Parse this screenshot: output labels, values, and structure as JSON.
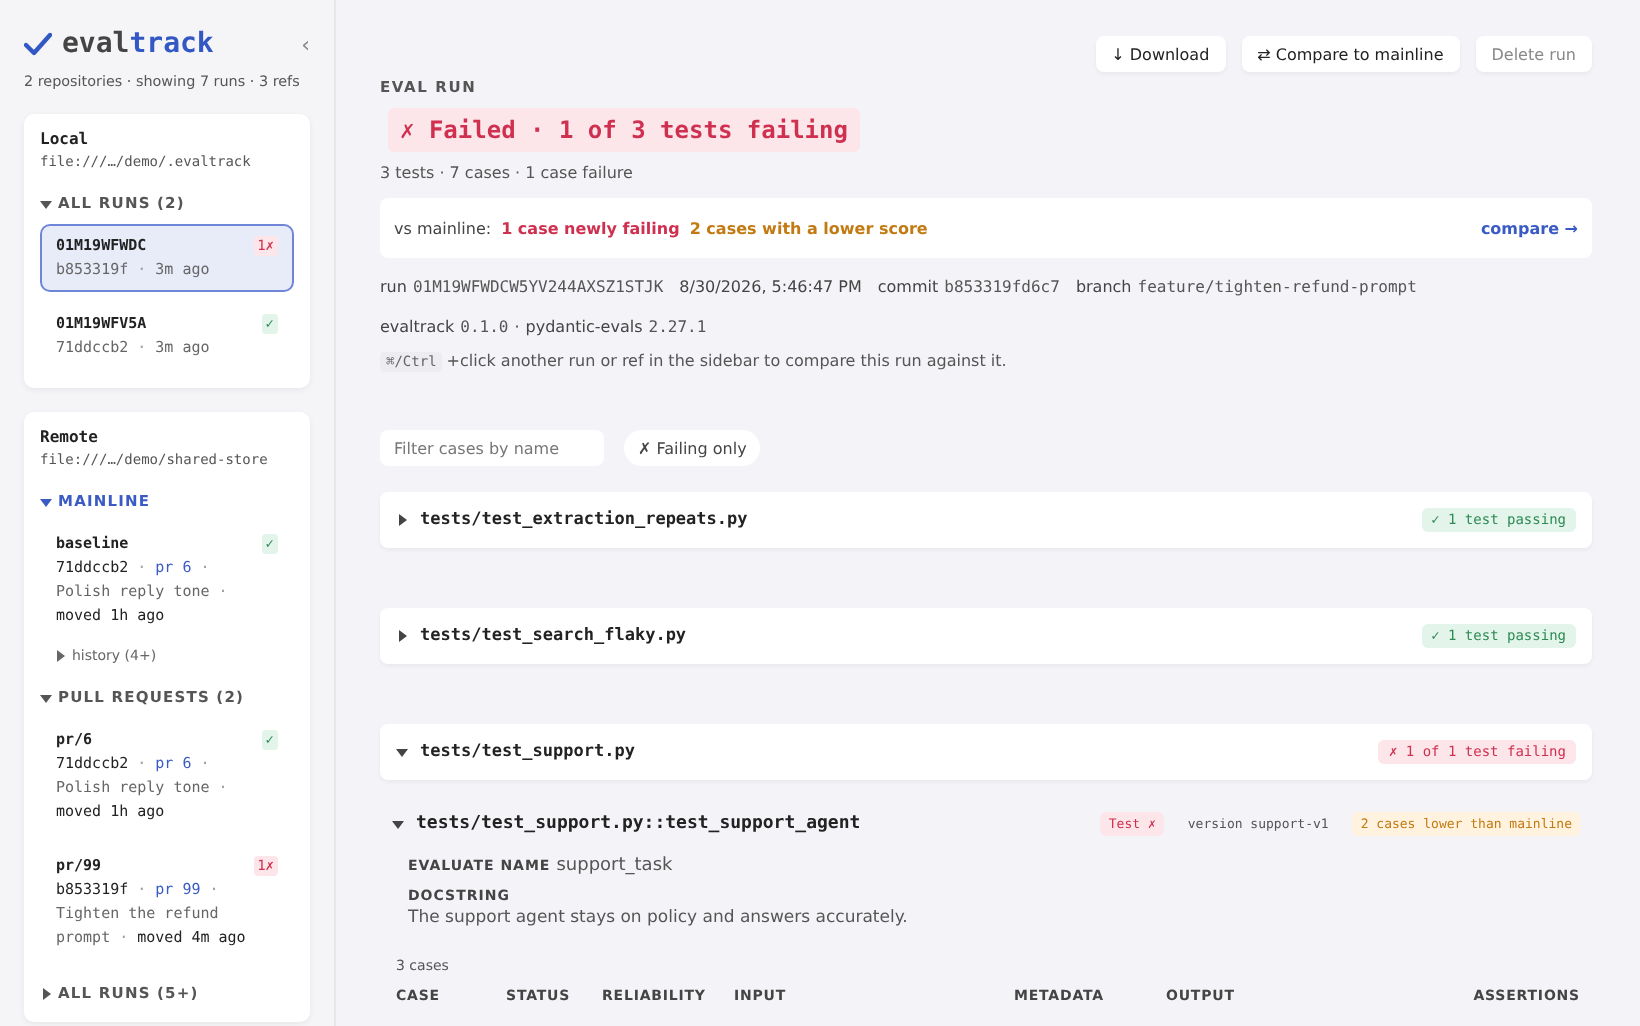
{
  "sidebar": {
    "brand": {
      "prefix": "eval",
      "suffix": "track"
    },
    "collapse": "‹",
    "summary": "2 repositories · showing 7 runs · 3 refs",
    "repos": [
      {
        "name": "Local",
        "path": "file:///…/demo/.evaltrack",
        "sections": [
          {
            "title": "ALL RUNS (2)",
            "accent": false,
            "expanded": true,
            "items": [
              {
                "kind": "run",
                "title": "01M19WFWDC",
                "meta": [
                  {
                    "kind": "text",
                    "text": "b853319f"
                  },
                  {
                    "kind": "sep",
                    "text": "·"
                  },
                  {
                    "kind": "text",
                    "text": "3m ago"
                  }
                ],
                "badge": {
                  "kind": "fail",
                  "text": "1✗"
                },
                "selected": true
              },
              {
                "kind": "run",
                "title": "01M19WFV5A",
                "meta": [
                  {
                    "kind": "text",
                    "text": "71ddccb2"
                  },
                  {
                    "kind": "sep",
                    "text": "·"
                  },
                  {
                    "kind": "text",
                    "text": "3m ago"
                  }
                ],
                "badge": {
                  "kind": "pass",
                  "text": "✓"
                },
                "selected": false
              }
            ]
          }
        ]
      },
      {
        "name": "Remote",
        "path": "file:///…/demo/shared-store",
        "sections": [
          {
            "title": "MAINLINE",
            "accent": true,
            "expanded": true,
            "items": [
              {
                "kind": "ref",
                "title": "baseline",
                "meta": [
                  {
                    "kind": "commit",
                    "text": "71ddccb2"
                  },
                  {
                    "kind": "sep",
                    "text": "·"
                  },
                  {
                    "kind": "link",
                    "text": "pr 6"
                  },
                  {
                    "kind": "sep",
                    "text": "·"
                  },
                  {
                    "kind": "text",
                    "text": "Polish reply tone"
                  },
                  {
                    "kind": "sep",
                    "text": "·"
                  },
                  {
                    "kind": "strong",
                    "text": "moved 1h ago"
                  }
                ],
                "badge": {
                  "kind": "pass",
                  "text": "✓"
                },
                "selected": false
              },
              {
                "kind": "history",
                "title": "history (4+)",
                "expanded": false
              }
            ]
          },
          {
            "title": "PULL REQUESTS (2)",
            "accent": false,
            "expanded": true,
            "items": [
              {
                "kind": "ref",
                "title": "pr/6",
                "meta": [
                  {
                    "kind": "commit",
                    "text": "71ddccb2"
                  },
                  {
                    "kind": "sep",
                    "text": "·"
                  },
                  {
                    "kind": "link",
                    "text": "pr 6"
                  },
                  {
                    "kind": "sep",
                    "text": "·"
                  },
                  {
                    "kind": "text",
                    "text": "Polish reply tone"
                  },
                  {
                    "kind": "sep",
                    "text": "·"
                  },
                  {
                    "kind": "strong",
                    "text": "moved 1h ago"
                  }
                ],
                "badge": {
                  "kind": "pass",
                  "text": "✓"
                },
                "selected": false
              },
              {
                "kind": "ref",
                "title": "pr/99",
                "meta": [
                  {
                    "kind": "commit",
                    "text": "b853319f"
                  },
                  {
                    "kind": "sep",
                    "text": "·"
                  },
                  {
                    "kind": "link",
                    "text": "pr 99"
                  },
                  {
                    "kind": "sep",
                    "text": "·"
                  },
                  {
                    "kind": "text",
                    "text": "Tighten the refund prompt"
                  },
                  {
                    "kind": "sep",
                    "text": "·"
                  },
                  {
                    "kind": "strong",
                    "text": "moved 4m ago"
                  }
                ],
                "badge": {
                  "kind": "fail",
                  "text": "1✗"
                },
                "selected": false
              }
            ]
          },
          {
            "title": "ALL RUNS (5+)",
            "accent": false,
            "expanded": false
          }
        ]
      }
    ]
  },
  "main": {
    "actions": [
      {
        "kind": "normal",
        "label": "↓ Download"
      },
      {
        "kind": "normal",
        "label": "⇄ Compare to mainline"
      },
      {
        "kind": "muted",
        "label": "Delete run"
      }
    ],
    "eyebrow": "EVAL RUN",
    "status": {
      "kind": "failed",
      "text": "✗ Failed · 1 of 3 tests failing"
    },
    "stats": "3 tests · 7 cases · 1 case failure",
    "comparison": {
      "prefix": "vs mainline:",
      "items": [
        {
          "kind": "fail",
          "text": "1 case newly failing"
        },
        {
          "kind": "warn",
          "text": "2 cases with a lower score"
        }
      ],
      "link": "compare →"
    },
    "meta_lines": [
      [
        {
          "label": "run",
          "value": "01M19WFWDCW5YV244AXSZ1STJK"
        },
        {
          "label": "8/30/2026, 5:46:47 PM"
        },
        {
          "label": "commit",
          "value": "b853319fd6c7"
        },
        {
          "label": "branch",
          "value": "feature/tighten-refund-prompt"
        }
      ],
      [
        {
          "label": "evaltrack",
          "value": "0.1.0"
        },
        {
          "label": "·"
        },
        {
          "label": "pydantic-evals",
          "value": "2.27.1"
        }
      ]
    ],
    "hint": {
      "key": "⌘/Ctrl",
      "text": "+click another run or ref in the sidebar to compare this run against it."
    },
    "filter": {
      "placeholder": "Filter cases by name",
      "toggle": {
        "label": "✗ Failing only",
        "on": false
      }
    },
    "files": [
      {
        "name": "tests/test_extraction_repeats.py",
        "expanded": false,
        "badge": {
          "kind": "pass",
          "text": "✓ 1 test passing"
        }
      },
      {
        "name": "tests/test_search_flaky.py",
        "expanded": false,
        "badge": {
          "kind": "pass",
          "text": "✓ 1 test passing"
        }
      },
      {
        "name": "tests/test_support.py",
        "expanded": true,
        "badge": {
          "kind": "fail",
          "text": "✗ 1 of 1 test failing"
        },
        "tests": [
          {
            "name": "tests/test_support.py::test_support_agent",
            "expanded": true,
            "tags": [
              {
                "kind": "fail",
                "text": "Test ✗"
              },
              {
                "kind": "neutral",
                "text": "version support-v1"
              },
              {
                "kind": "warn",
                "text": "2 cases lower than mainline"
              }
            ],
            "evaluate_label": "EVALUATE NAME",
            "evaluate_value": "support_task",
            "docstring_label": "DOCSTRING",
            "docstring": "The support agent stays on policy and answers accurately.",
            "case_count": "3 cases",
            "columns": [
              "CASE",
              "STATUS",
              "RELIABILITY",
              "INPUT",
              "METADATA",
              "OUTPUT",
              "ASSERTIONS"
            ]
          }
        ]
      }
    ]
  }
}
